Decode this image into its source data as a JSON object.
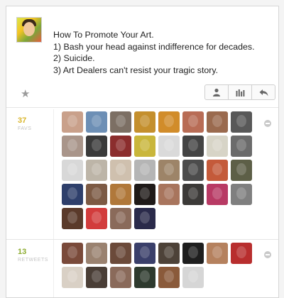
{
  "tweet": {
    "lines": [
      "How To Promote Your Art.",
      "1) Bash your head against indifference for decades.",
      "2) Suicide.",
      "3) Art Dealers can't resist your tragic story."
    ]
  },
  "actions": {
    "icons": [
      "user-icon",
      "stats-icon",
      "reply-icon"
    ]
  },
  "stats": {
    "favorites": {
      "count": "37",
      "label": "FAVS"
    },
    "retweets": {
      "count": "13",
      "label": "RETWEETS"
    }
  },
  "colors": {
    "count_green": "#8cab2f",
    "count_orange": "#d9b52a",
    "border": "#d6d6d6",
    "icon_gray": "#9b9b9b"
  },
  "favorites_avatars": [
    "#c9a08a",
    "#6d8fb5",
    "#7c6f64",
    "#c48f2d",
    "#d18c2a",
    "#b86c55",
    "#9a6a4e",
    "#585858",
    "#a9958a",
    "#3a3a3a",
    "#8b2d2d",
    "#c9b63b",
    "#dadada",
    "#444444",
    "#d7d4c7",
    "#6b6b6b",
    "#d8d8d8",
    "#bdb5a8",
    "#cfc0ae",
    "#b5b5b5",
    "#9d8468",
    "#4c4c4c",
    "#c45a3a",
    "#5d5f47",
    "#2e3f6b",
    "#7c5a44",
    "#b0783a",
    "#1f1a18",
    "#a8755d",
    "#3c3a38",
    "#b83a64",
    "#7f7f7f",
    "#5a3a2a",
    "#d23c3c",
    "#8a6a5a",
    "#2a2a4a"
  ],
  "retweets_avatars": [
    "#7a4a3a",
    "#9a8270",
    "#6b4a3a",
    "#3a3f6a",
    "#4d4238",
    "#1e1e1e",
    "#b5815e",
    "#b82e2e",
    "#d9d0c5",
    "#4a3e36",
    "#8a6a5a",
    "#2e3a2e",
    "#8a5a3a",
    "#d6d6d6"
  ]
}
